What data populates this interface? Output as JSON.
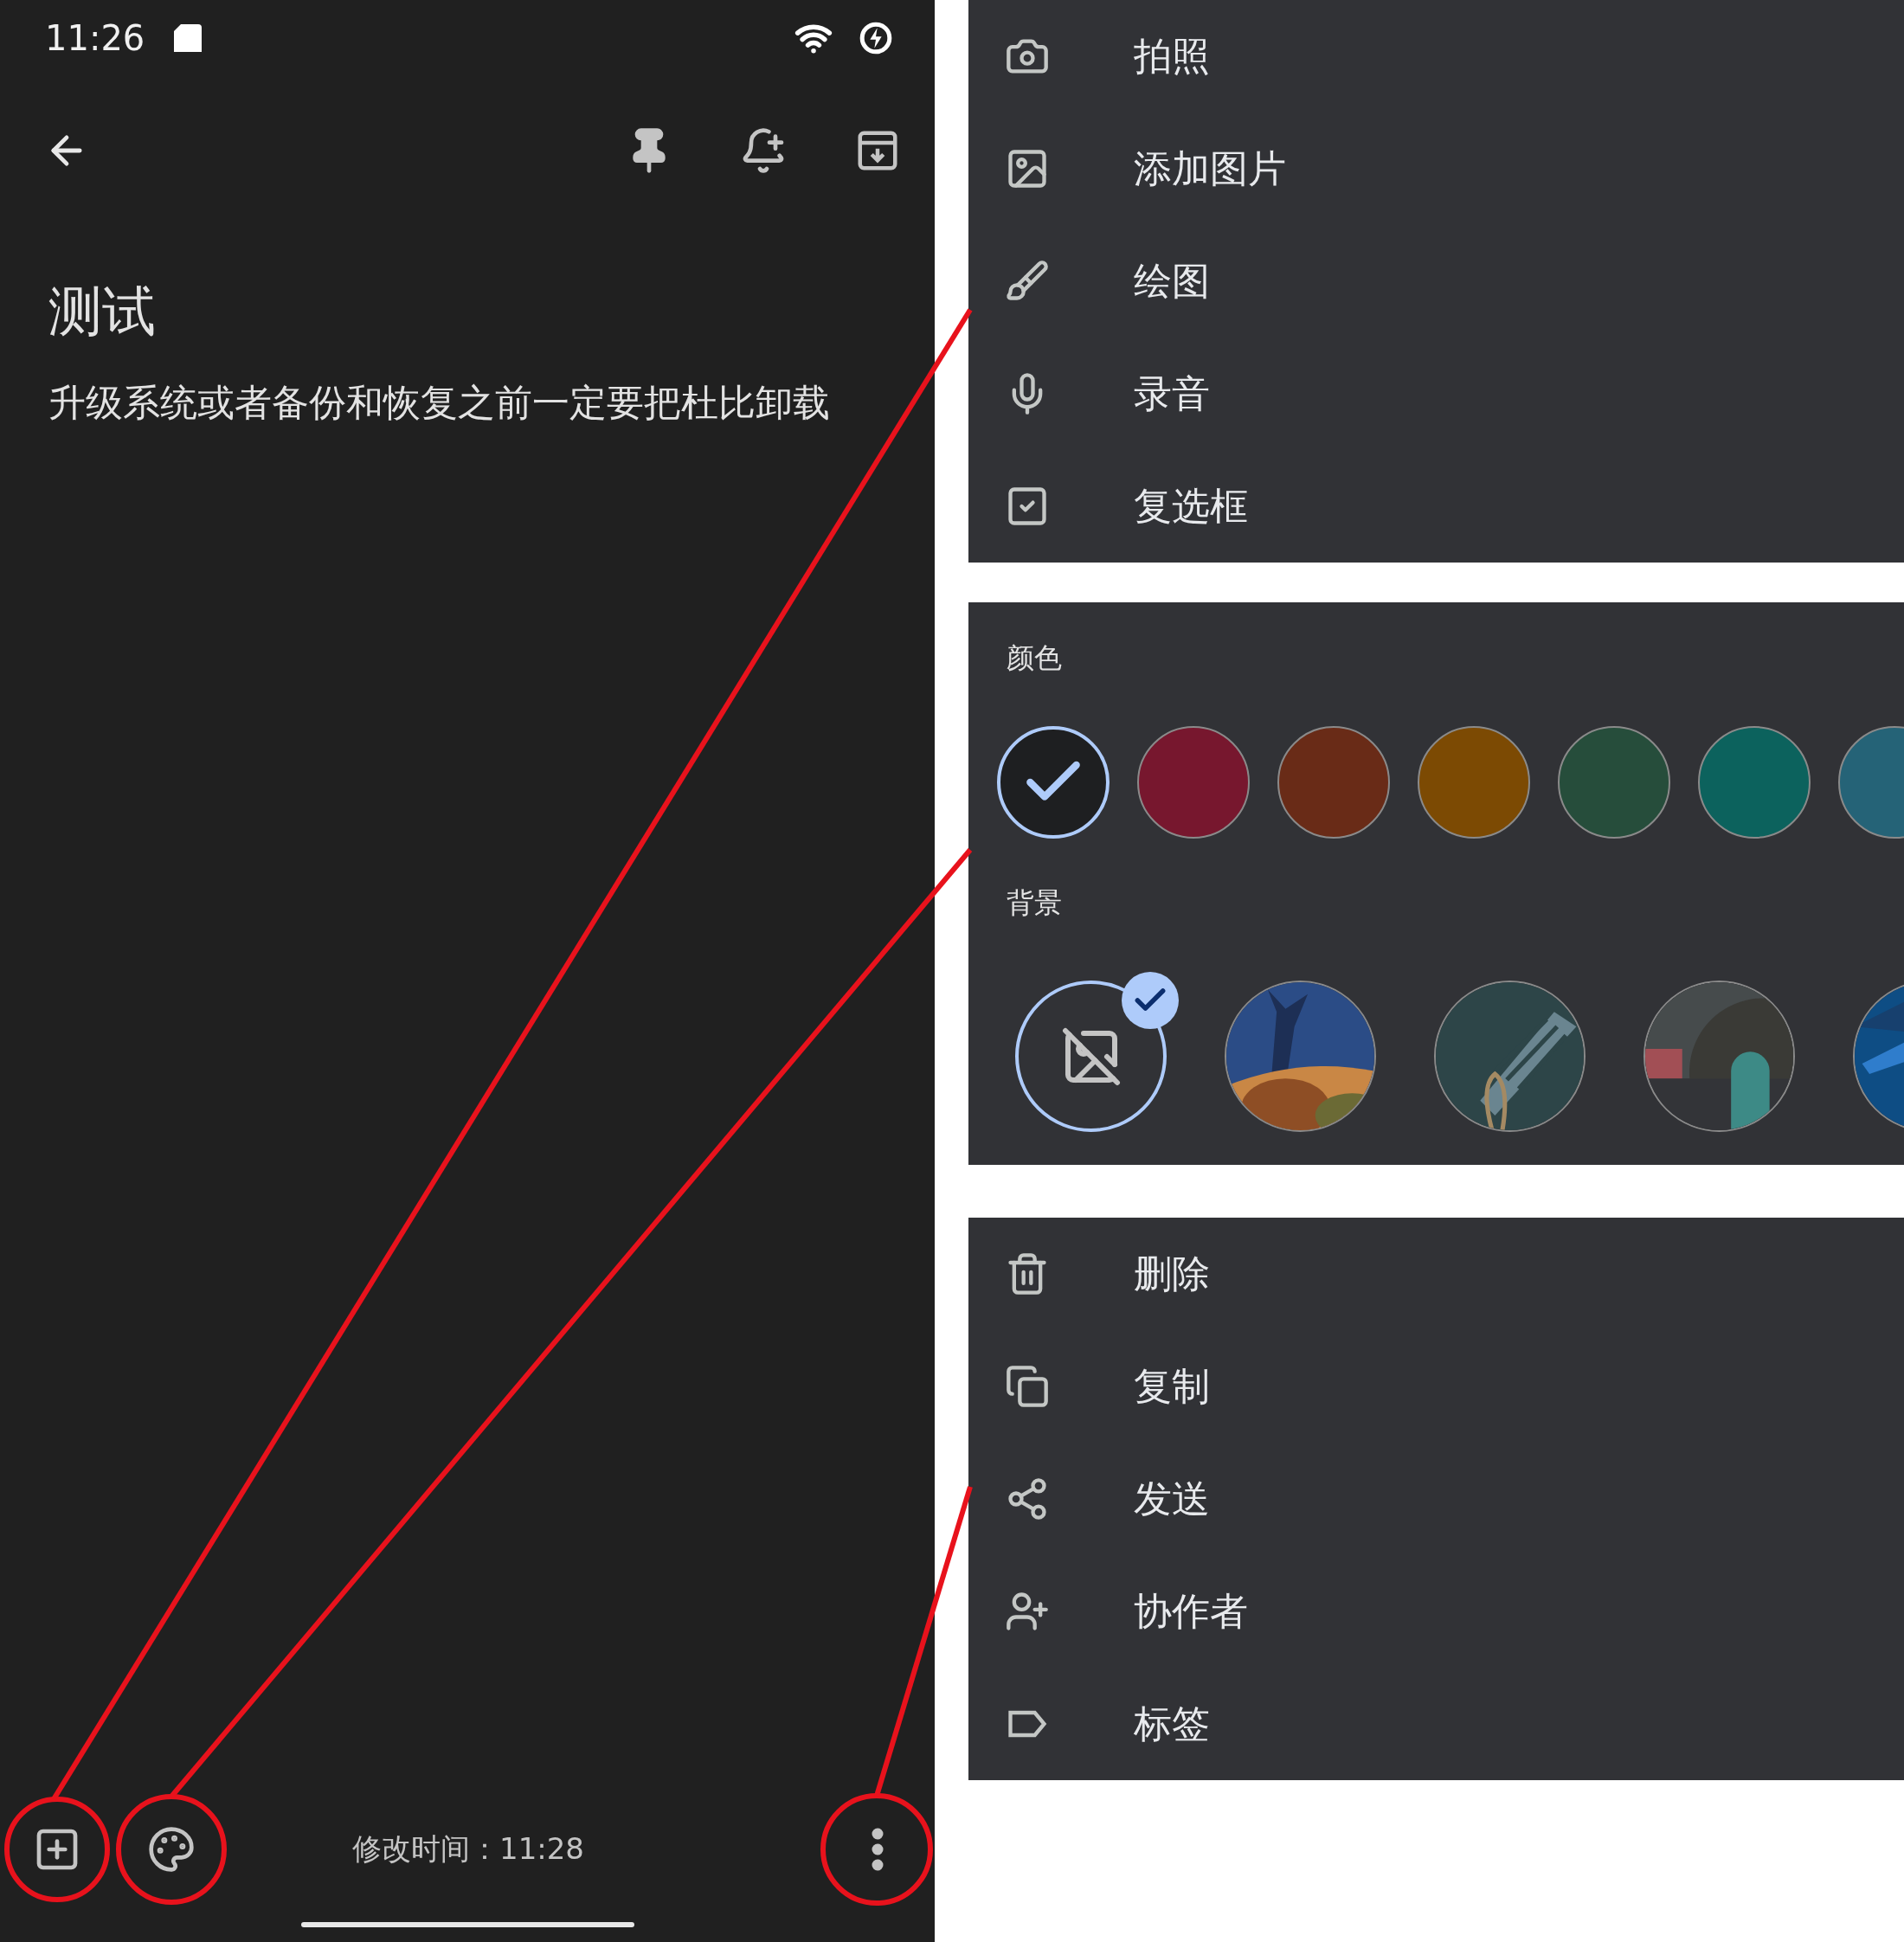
{
  "status_bar": {
    "time": "11:26"
  },
  "note": {
    "title": "测试",
    "body": "升级系统或者备份和恢复之前一定要把杜比卸载"
  },
  "bottom_bar": {
    "modified": "修改时间：11:28"
  },
  "insert_menu": {
    "items": [
      {
        "label": "拍照"
      },
      {
        "label": "添加图片"
      },
      {
        "label": "绘图"
      },
      {
        "label": "录音"
      },
      {
        "label": "复选框"
      }
    ]
  },
  "color_panel": {
    "colors_label": "颜色",
    "colors": [
      {
        "color": "#1e1f21",
        "selected": true
      },
      {
        "color": "#77172e",
        "selected": false
      },
      {
        "color": "#692b17",
        "selected": false
      },
      {
        "color": "#7c4a03",
        "selected": false
      },
      {
        "color": "#264d3b",
        "selected": false
      },
      {
        "color": "#0c625d",
        "selected": false
      },
      {
        "color": "#256377",
        "selected": false
      }
    ],
    "backgrounds_label": "背景",
    "backgrounds": [
      {
        "kind": "none",
        "selected": true
      },
      {
        "kind": "picture",
        "selected": false
      },
      {
        "kind": "picture",
        "selected": false
      },
      {
        "kind": "picture",
        "selected": false
      },
      {
        "kind": "picture",
        "selected": false
      }
    ]
  },
  "more_menu": {
    "items": [
      {
        "label": "删除"
      },
      {
        "label": "复制"
      },
      {
        "label": "发送"
      },
      {
        "label": "协作者"
      },
      {
        "label": "标签"
      }
    ]
  }
}
